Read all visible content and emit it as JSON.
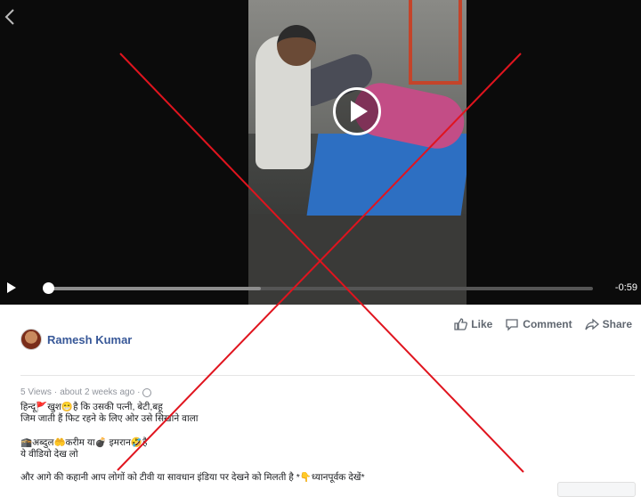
{
  "video": {
    "duration_remaining": "-0:59",
    "progress_fraction": 0.0,
    "buffered_fraction": 0.39
  },
  "actions": {
    "like_label": "Like",
    "comment_label": "Comment",
    "share_label": "Share"
  },
  "author": {
    "name": "Ramesh Kumar"
  },
  "meta": {
    "views": "5 Views",
    "separator": " · ",
    "time": "about 2 weeks ago",
    "separator2": " · "
  },
  "post": {
    "line1": "हिन्दू🚩खुश😁है कि उसकी पत्नी, बेटी,बहू",
    "line2": "जिम जाती हैं फिट रहने के लिए ओर उसे सिखाने वाला",
    "line3": "🕋अब्दुल🤲करीम या💣 इमरान🤣है",
    "line4": "ये वीडियो देख लो",
    "line5": "और आगे की कहानी आप लोगों को टीवी या सावधान इंडिया पर देखने को मिलती है *👇ध्यानपूर्वक देखें*"
  },
  "colors": {
    "cross": "#e0141e",
    "author_link": "#385898",
    "meta_text": "#90949c"
  },
  "icons": [
    "back-arrow-icon",
    "play-icon",
    "like-icon",
    "comment-icon",
    "share-icon",
    "globe-icon"
  ]
}
